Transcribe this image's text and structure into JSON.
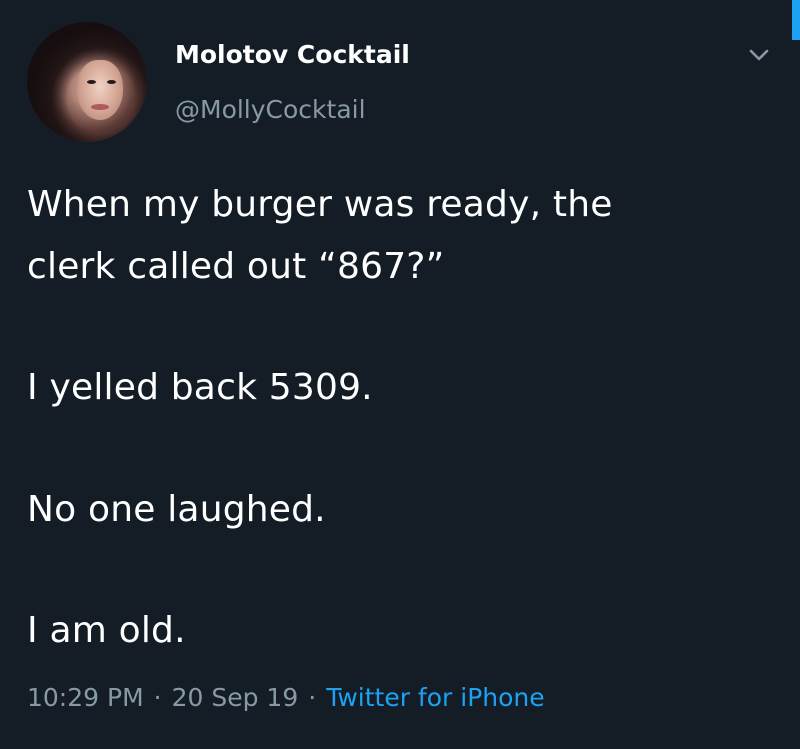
{
  "user": {
    "display_name": "Molotov Cocktail",
    "handle": "@MollyCocktail"
  },
  "tweet": {
    "lines": [
      "When my burger was ready, the",
      "clerk called out “867?”",
      "I yelled back 5309.",
      "No one laughed.",
      "I am old."
    ],
    "time": "10:29 PM",
    "date": "20 Sep 19",
    "source": "Twitter for iPhone",
    "separator": "·"
  },
  "icons": {
    "menu": "chevron-down-icon",
    "avatar": "profile-photo"
  },
  "colors": {
    "background": "#141d26",
    "text": "#ffffff",
    "secondary": "#8899a6",
    "accent": "#1da1f2"
  }
}
